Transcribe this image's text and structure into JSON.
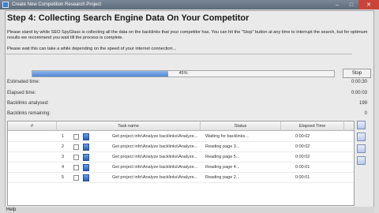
{
  "window": {
    "title": "Create New Competition Research Project",
    "controls": [
      "minimize",
      "maximize",
      "close"
    ]
  },
  "step": {
    "title": "Step 4: Collecting Search Engine Data On Your Competitor",
    "description": "Please stand by while SEO SpyGlass is collecting all the data on the backlinks that your competitor has. You can hit the \"Stop\" button at any time to interrupt the search, but for optimum results we recommend you wait till the process is complete.",
    "wait_note": "Please wait this can take a while depending on the speed of your internet connection..."
  },
  "progress": {
    "percent": 45,
    "label": "45%",
    "stop_label": "Stop"
  },
  "stats": [
    {
      "label": "Estimated time:",
      "value": "0:00:30"
    },
    {
      "label": "Elapsed time:",
      "value": "0:00:03"
    },
    {
      "label": "Backlinks analysed:",
      "value": "199"
    },
    {
      "label": "Backlinks remaining:",
      "value": "0"
    }
  ],
  "table": {
    "columns": [
      "#",
      "Task name",
      "Status",
      "Elapsed Time"
    ],
    "rows": [
      {
        "num": "1",
        "task": "Get project info\\Analyze backlinks\\Analyze...",
        "status": "Waiting for backlinks...",
        "time": "0:00:02"
      },
      {
        "num": "2",
        "task": "Get project info\\Analyze backlinks\\Analyze...",
        "status": "Reading page 3...",
        "time": "0:00:02"
      },
      {
        "num": "3",
        "task": "Get project info\\Analyze backlinks\\Analyze...",
        "status": "Reading page 5...",
        "time": "0:00:02"
      },
      {
        "num": "4",
        "task": "Get project info\\Analyze backlinks\\Analyze...",
        "status": "Reading page 4...",
        "time": "0:00:01"
      },
      {
        "num": "5",
        "task": "Get project info\\Analyze backlinks\\Analyze...",
        "status": "Reading page 2...",
        "time": "0:00:01"
      }
    ]
  },
  "footer": {
    "help_label": "Help"
  }
}
